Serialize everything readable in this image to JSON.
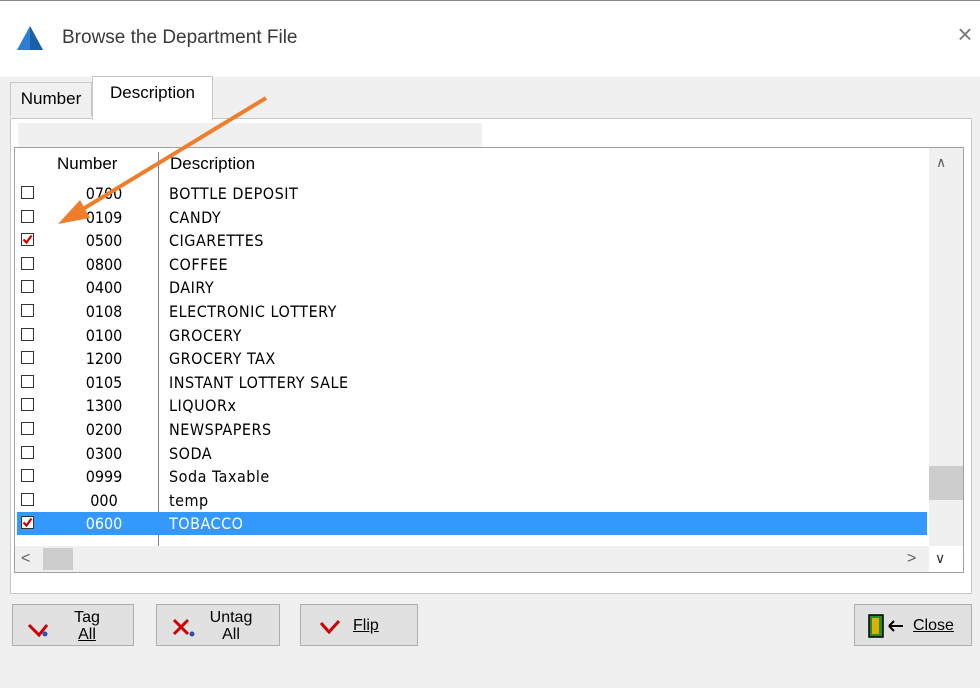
{
  "window": {
    "title": "Browse the Department File",
    "close_glyph": "×"
  },
  "tabs": [
    {
      "label": "Number"
    },
    {
      "label": "Description"
    }
  ],
  "grid": {
    "headers": {
      "number": "Number",
      "description": "Description"
    },
    "rows": [
      {
        "number": "0700",
        "description": "BOTTLE DEPOSIT",
        "checked": false
      },
      {
        "number": "0109",
        "description": "CANDY",
        "checked": false
      },
      {
        "number": "0500",
        "description": "CIGARETTES",
        "checked": true
      },
      {
        "number": "0800",
        "description": "COFFEE",
        "checked": false
      },
      {
        "number": "0400",
        "description": "DAIRY",
        "checked": false
      },
      {
        "number": "0108",
        "description": "ELECTRONIC LOTTERY",
        "checked": false
      },
      {
        "number": "0100",
        "description": "GROCERY",
        "checked": false
      },
      {
        "number": "1200",
        "description": "GROCERY TAX",
        "checked": false
      },
      {
        "number": "0105",
        "description": "INSTANT LOTTERY SALE",
        "checked": false
      },
      {
        "number": "1300",
        "description": "LIQUORx",
        "checked": false
      },
      {
        "number": "0200",
        "description": "NEWSPAPERS",
        "checked": false
      },
      {
        "number": "0300",
        "description": "SODA",
        "checked": false
      },
      {
        "number": "0999",
        "description": "Soda Taxable",
        "checked": false
      },
      {
        "number": "000",
        "description": "temp",
        "checked": false
      },
      {
        "number": "0600",
        "description": "TOBACCO",
        "checked": true,
        "selected": true
      }
    ]
  },
  "buttons": {
    "tag_all": {
      "line1": "Tag",
      "line2": "All"
    },
    "untag_all": {
      "line1": "Untag",
      "line2": "All"
    },
    "flip": {
      "label": "Flip"
    },
    "close": {
      "label": "Close"
    }
  },
  "colors": {
    "selection": "#3399ff",
    "annotation_arrow": "#f07d2a",
    "check_mark": "#cc0000"
  }
}
